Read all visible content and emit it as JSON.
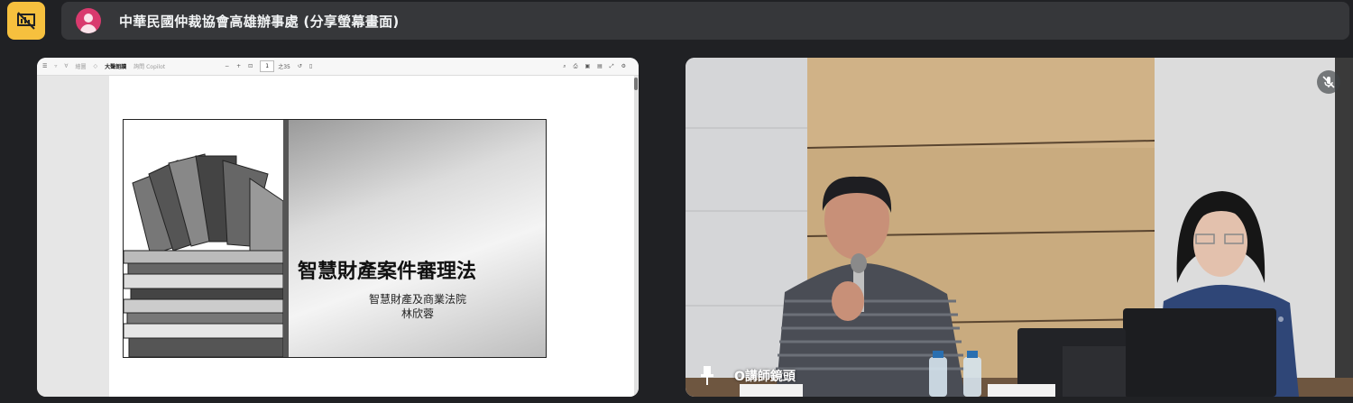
{
  "window": {
    "title": "中華民國仲裁協會高雄辦事處 (分享螢幕畫面)",
    "present_icon": "no-present-icon",
    "avatar_icon": "person-avatar-icon"
  },
  "pdf_viewer": {
    "toolbar": {
      "read_aloud": "大聲朗讀",
      "copilot": "詢問 Copilot",
      "draw": "繪圖",
      "page_current": "1",
      "page_total": "之35"
    }
  },
  "slide": {
    "title": "智慧財產案件審理法",
    "subtitle_line1": "智慧財產及商業法院",
    "subtitle_line2": "林欣蓉"
  },
  "camera": {
    "label": "O講師鏡頭",
    "mic_state": "muted"
  },
  "colors": {
    "accent": "#f6c03e",
    "background": "#202124",
    "title_bar": "#36373a",
    "avatar": "#d93a6e"
  }
}
